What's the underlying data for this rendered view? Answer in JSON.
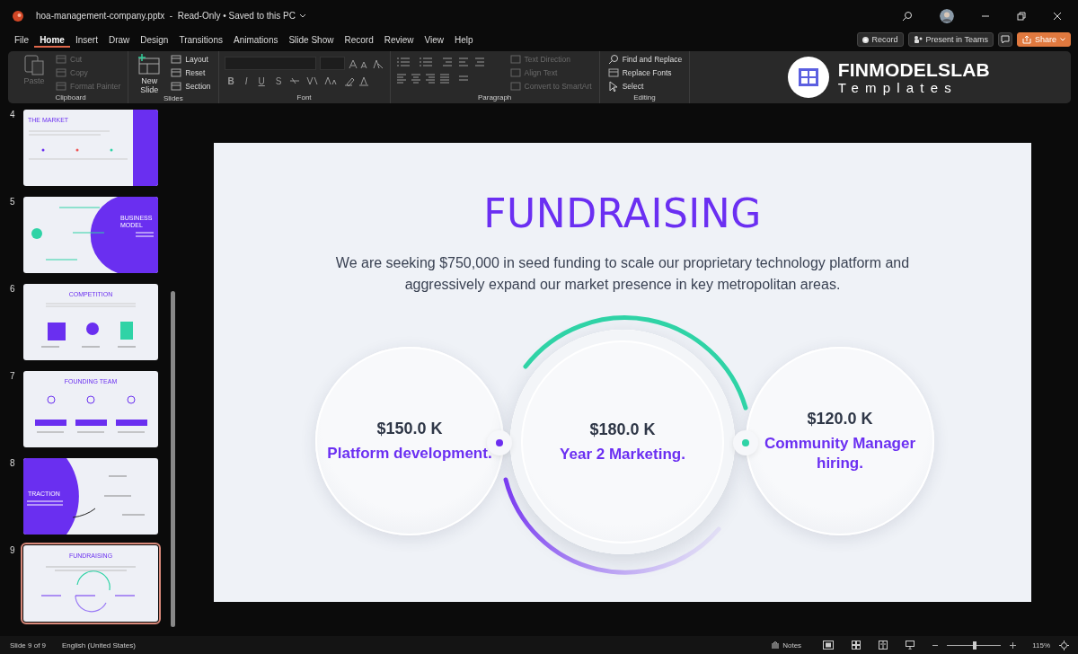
{
  "title_bar": {
    "title": "hoa-management-company.pptx  -  Read-Only • Saved to this PC"
  },
  "menu_tabs": [
    {
      "label": "File",
      "selected": false
    },
    {
      "label": "Home",
      "selected": true
    },
    {
      "label": "Insert",
      "selected": false
    },
    {
      "label": "Draw",
      "selected": false
    },
    {
      "label": "Design",
      "selected": false
    },
    {
      "label": "Transitions",
      "selected": false
    },
    {
      "label": "Animations",
      "selected": false
    },
    {
      "label": "Slide Show",
      "selected": false
    },
    {
      "label": "Record",
      "selected": false
    },
    {
      "label": "Review",
      "selected": false
    },
    {
      "label": "View",
      "selected": false
    },
    {
      "label": "Help",
      "selected": false
    }
  ],
  "actions": [
    {
      "label": "Record",
      "kind": "record"
    },
    {
      "label": "Present in Teams",
      "kind": "teams"
    },
    {
      "label": "Share",
      "kind": "share"
    }
  ],
  "ribbon": [
    {
      "kind": "commands",
      "label": "Clipboard",
      "large": {
        "label": "Paste",
        "disabled": true
      },
      "items": [
        {
          "label": "Cut",
          "disabled": true
        },
        {
          "label": "Copy",
          "disabled": true
        },
        {
          "label": "Format Painter",
          "disabled": true
        }
      ]
    },
    {
      "kind": "commands",
      "label": "Slides",
      "large": {
        "label": "New Slide",
        "disabled": false
      },
      "items": [
        {
          "label": "Layout",
          "disabled": false
        },
        {
          "label": "Reset",
          "disabled": false
        },
        {
          "label": "Section",
          "disabled": false
        }
      ]
    },
    {
      "kind": "font",
      "label": "Font",
      "buttons": [
        "B",
        "I",
        "U",
        "S"
      ]
    },
    {
      "kind": "paragraph",
      "label": "Paragraph",
      "items": [
        {
          "label": "Text Direction",
          "disabled": true
        },
        {
          "label": "Align Text",
          "disabled": true
        },
        {
          "label": "Convert to SmartArt",
          "disabled": true
        }
      ]
    },
    {
      "kind": "commands",
      "label": "Editing",
      "items": [
        {
          "label": "Find and Replace",
          "disabled": false
        },
        {
          "label": "Replace Fonts",
          "disabled": false
        },
        {
          "label": "Select",
          "disabled": false
        }
      ]
    }
  ],
  "logo": {
    "name": "FINMODELSLAB",
    "tagline": "Templates"
  },
  "thumbnails": [
    {
      "number": "4",
      "title": "THE MARKET",
      "kind": "market",
      "selected": false
    },
    {
      "number": "5",
      "title": "BUSINESS MODEL",
      "kind": "business",
      "selected": false
    },
    {
      "number": "6",
      "title": "COMPETITION",
      "kind": "competition",
      "selected": false
    },
    {
      "number": "7",
      "title": "FOUNDING TEAM",
      "kind": "team",
      "selected": false
    },
    {
      "number": "8",
      "title": "TRACTION",
      "kind": "traction",
      "selected": false
    },
    {
      "number": "9",
      "title": "FUNDRAISING",
      "kind": "fundraising",
      "selected": true
    }
  ],
  "slide": {
    "title": "FUNDRAISING",
    "body": "We are seeking $750,000 in seed funding to scale our proprietary technology platform and aggressively expand our market presence in key metropolitan areas.",
    "items": [
      {
        "amount": "$150.0 K",
        "label": "Platform development."
      },
      {
        "amount": "$180.0 K",
        "label": "Year 2 Marketing."
      },
      {
        "amount": "$120.0 K",
        "label": "Community Manager hiring."
      }
    ],
    "connectors": [
      {
        "color": "#6c2ef0"
      },
      {
        "color": "#2fd3a6"
      }
    ]
  },
  "status_bar": {
    "slide": "Slide 9 of 9",
    "language": "English (United States)",
    "notes": "Notes",
    "zoom": {
      "level": 0.52,
      "reading": "115%"
    }
  }
}
